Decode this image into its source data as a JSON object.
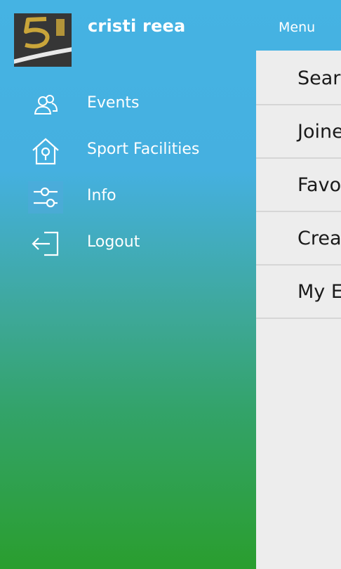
{
  "header": {
    "username": "cristi reea",
    "menu_title": "Menu",
    "avatar_alt": "profile picture"
  },
  "nav": {
    "items": [
      {
        "label": "Events",
        "icon": "people-icon"
      },
      {
        "label": "Sport Facilities",
        "icon": "house-icon"
      },
      {
        "label": "Info",
        "icon": "sliders-icon"
      },
      {
        "label": "Logout",
        "icon": "logout-icon"
      }
    ]
  },
  "panel": {
    "items": [
      {
        "label": "Sear"
      },
      {
        "label": "Joine"
      },
      {
        "label": "Favo"
      },
      {
        "label": "Crea"
      },
      {
        "label": "My E"
      }
    ]
  },
  "colors": {
    "gradient_top": "#45b3e3",
    "gradient_bottom": "#2a9e2e",
    "panel_bg": "#ededed",
    "text_light": "#ffffff",
    "text_dark": "#1a1a1a"
  }
}
